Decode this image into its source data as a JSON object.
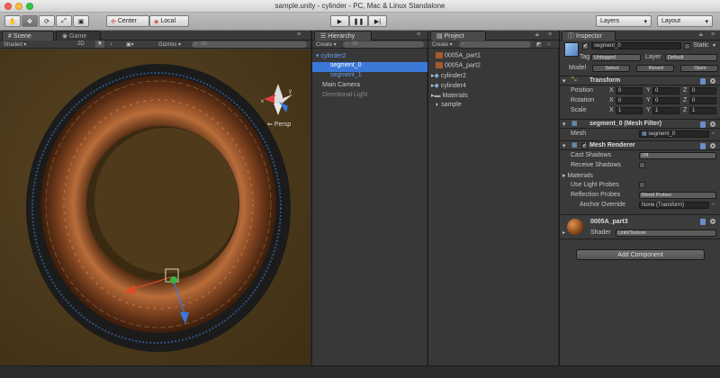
{
  "window": {
    "title": "sample.unity - cylinder - PC, Mac & Linux Standalone"
  },
  "toolbar": {
    "pivot_label": "Center",
    "space_label": "Local",
    "layers_label": "Layers",
    "layout_label": "Layout"
  },
  "scene": {
    "tab_scene": "Scene",
    "tab_game": "Game",
    "shading_mode": "Shaded",
    "mode_2d": "2D",
    "gizmos_label": "Gizmos",
    "search_placeholder": "All",
    "persp_label": "Persp",
    "axis_x": "x",
    "axis_y": "y"
  },
  "hierarchy": {
    "tab": "Hierarchy",
    "create_label": "Create",
    "search_placeholder": "All",
    "items": [
      {
        "label": "cylinder2"
      },
      {
        "label": "segment_0"
      },
      {
        "label": "segment_1"
      },
      {
        "label": "Main Camera"
      },
      {
        "label": "Directional Light"
      }
    ]
  },
  "project": {
    "tab": "Project",
    "create_label": "Create",
    "items": [
      {
        "label": "0005A_part1"
      },
      {
        "label": "0005A_part2"
      },
      {
        "label": "cylinder2"
      },
      {
        "label": "cylinder4"
      },
      {
        "label": "Materials"
      },
      {
        "label": "sample"
      }
    ]
  },
  "inspector": {
    "tab": "Inspector",
    "object_name": "segment_0",
    "static_label": "Static",
    "tag_label": "Tag",
    "tag_value": "Untagged",
    "layer_label": "Layer",
    "layer_value": "Default",
    "model_label": "Model",
    "select_label": "Select",
    "revert_label": "Revert",
    "open_label": "Open",
    "transform": {
      "title": "Transform",
      "position_label": "Position",
      "rotation_label": "Rotation",
      "scale_label": "Scale",
      "x": "X",
      "y": "Y",
      "z": "Z",
      "position": [
        "0",
        "0",
        "0"
      ],
      "rotation": [
        "0",
        "0",
        "0"
      ],
      "scale": [
        "1",
        "1",
        "1"
      ]
    },
    "mesh_filter": {
      "title": "segment_0 (Mesh Filter)",
      "mesh_label": "Mesh",
      "mesh_value": "segment_0"
    },
    "mesh_renderer": {
      "title": "Mesh Renderer",
      "cast_shadows_label": "Cast Shadows",
      "cast_shadows_value": "Off",
      "receive_shadows_label": "Receive Shadows",
      "materials_label": "Materials",
      "light_probes_label": "Use Light Probes",
      "reflection_probes_label": "Reflection Probes",
      "reflection_probes_value": "Blend Probes",
      "anchor_override_label": "Anchor Override",
      "anchor_override_value": "None (Transform)"
    },
    "material": {
      "name": "0005A_part3",
      "shader_label": "Shader",
      "shader_value": "Unlit/Texture"
    },
    "add_component_label": "Add Component"
  },
  "colors": {
    "selection_blue": "#3c78d8",
    "scene_bg": "#4a3a1e",
    "panel_bg": "#3a3a3a"
  }
}
